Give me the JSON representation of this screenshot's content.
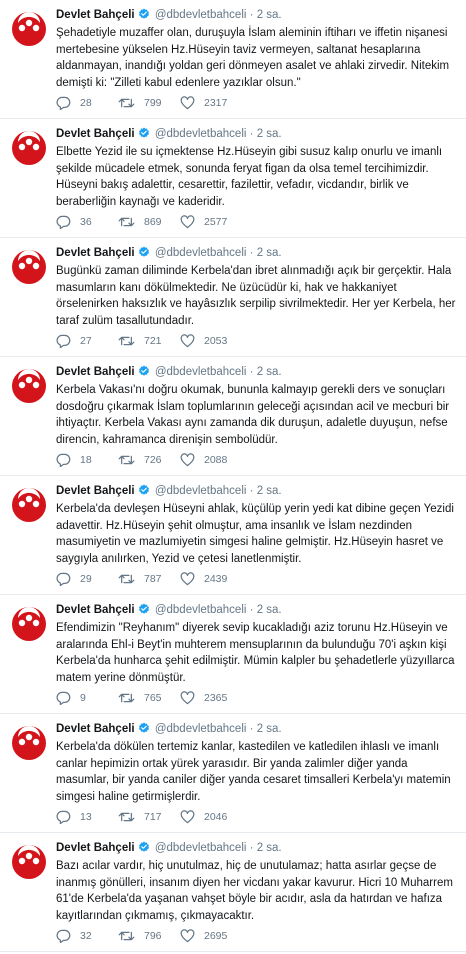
{
  "tweets": [
    {
      "name": "Devlet Bahçeli",
      "handle": "@dbdevletbahceli",
      "separator": "·",
      "time": "2 sa.",
      "text": "Şehadetiyle muzaffer olan, duruşuyla İslam aleminin iftiharı ve iffetin nişanesi\nmertebesine yükselen Hz.Hüseyin taviz vermeyen, saltanat hesaplarına\naldanmayan, inandığı yoldan geri dönmeyen asalet ve ahlaki zirvedir. Nitekim\ndemişti ki: \"Zilleti kabul edenlere yazıklar olsun.\"",
      "replies": "28",
      "retweets": "799",
      "likes": "2317"
    },
    {
      "name": "Devlet Bahçeli",
      "handle": "@dbdevletbahceli",
      "separator": "·",
      "time": "2 sa.",
      "text": "Elbette Yezid ile su içmektense Hz.Hüseyin gibi susuz kalıp onurlu ve imanlı\nşekilde mücadele etmek, sonunda feryat figan da olsa temel tercihimizdir.\nHüseyni bakış adalettir, cesarettir, fazilettir, vefadır, vicdandır, birlik ve\nberaberliğin kaynağı ve kaderidir.",
      "replies": "36",
      "retweets": "869",
      "likes": "2577"
    },
    {
      "name": "Devlet Bahçeli",
      "handle": "@dbdevletbahceli",
      "separator": "·",
      "time": "2 sa.",
      "text": "Bugünkü zaman diliminde Kerbela'dan ibret alınmadığı açık bir gerçektir. Hala\nmasumların kanı dökülmektedir. Ne üzücüdür ki, hak ve hakkaniyet\nörselenirken haksızlık ve hayâsızlık serpilip sivrilmektedir. Her yer Kerbela, her\ntaraf zulüm tasallutundadır.",
      "replies": "27",
      "retweets": "721",
      "likes": "2053"
    },
    {
      "name": "Devlet Bahçeli",
      "handle": "@dbdevletbahceli",
      "separator": "·",
      "time": "2 sa.",
      "text": "Kerbela Vakası'nı doğru okumak, bununla kalmayıp gerekli ders ve sonuçları\ndosdoğru çıkarmak İslam toplumlarının geleceği açısından acil ve mecburi bir\nihtiyaçtır. Kerbela Vakası aynı zamanda dik duruşun, adaletle duyuşun, nefse\ndirencin, kahramanca direnişin sembolüdür.",
      "replies": "18",
      "retweets": "726",
      "likes": "2088"
    },
    {
      "name": "Devlet Bahçeli",
      "handle": "@dbdevletbahceli",
      "separator": "·",
      "time": "2 sa.",
      "text": "Kerbela'da devleşen Hüseyni ahlak, küçülüp yerin yedi kat dibine geçen Yezidi\nadavettir. Hz.Hüseyin şehit olmuştur, ama insanlık ve İslam nezdinden\nmasumiyetin ve mazlumiyetin simgesi haline gelmiştir. Hz.Hüseyin hasret ve\nsaygıyla anılırken, Yezid ve çetesi lanetlenmiştir.",
      "replies": "29",
      "retweets": "787",
      "likes": "2439"
    },
    {
      "name": "Devlet Bahçeli",
      "handle": "@dbdevletbahceli",
      "separator": "·",
      "time": "2 sa.",
      "text": "Efendimizin \"Reyhanım\" diyerek sevip kucakladığı aziz torunu Hz.Hüseyin ve\naralarında Ehl-i Beyt'in muhterem mensuplarının da bulunduğu 70'i aşkın kişi\nKerbela'da hunharca şehit edilmiştir. Mümin kalpler bu şehadetlerle yüzyıllarca\nmatem yerine dönmüştür.",
      "replies": "9",
      "retweets": "765",
      "likes": "2365"
    },
    {
      "name": "Devlet Bahçeli",
      "handle": "@dbdevletbahceli",
      "separator": "·",
      "time": "2 sa.",
      "text": "Kerbela'da dökülen tertemiz kanlar, kastedilen ve katledilen ihlaslı ve imanlı\ncanlar hepimizin ortak yürek yarasıdır. Bir yanda zalimler diğer yanda\nmasumlar, bir yanda caniler diğer yanda cesaret timsalleri Kerbela'yı matemin\nsimgesi haline getirmişlerdir.",
      "replies": "13",
      "retweets": "717",
      "likes": "2046"
    },
    {
      "name": "Devlet Bahçeli",
      "handle": "@dbdevletbahceli",
      "separator": "·",
      "time": "2 sa.",
      "text": "Bazı acılar vardır, hiç unutulmaz, hiç de unutulamaz; hatta asırlar geçse de\ninanmış gönülleri, insanım diyen her vicdanı yakar kavurur. Hicri 10 Muharrem\n61'de Kerbela'da yaşanan vahşet böyle bir acıdır, asla da hatırdan ve hafıza\nkayıtlarından çıkmamış, çıkmayacaktır.",
      "replies": "32",
      "retweets": "796",
      "likes": "2695"
    }
  ],
  "icons": {
    "reply": "reply-icon",
    "retweet": "retweet-icon",
    "like": "heart-icon",
    "verified": "verified-badge-icon"
  },
  "colors": {
    "text": "#14171a",
    "secondary": "#657786",
    "verified": "#1da1f2",
    "divider": "#e6ecf0",
    "avatar_red": "#d3141b"
  }
}
